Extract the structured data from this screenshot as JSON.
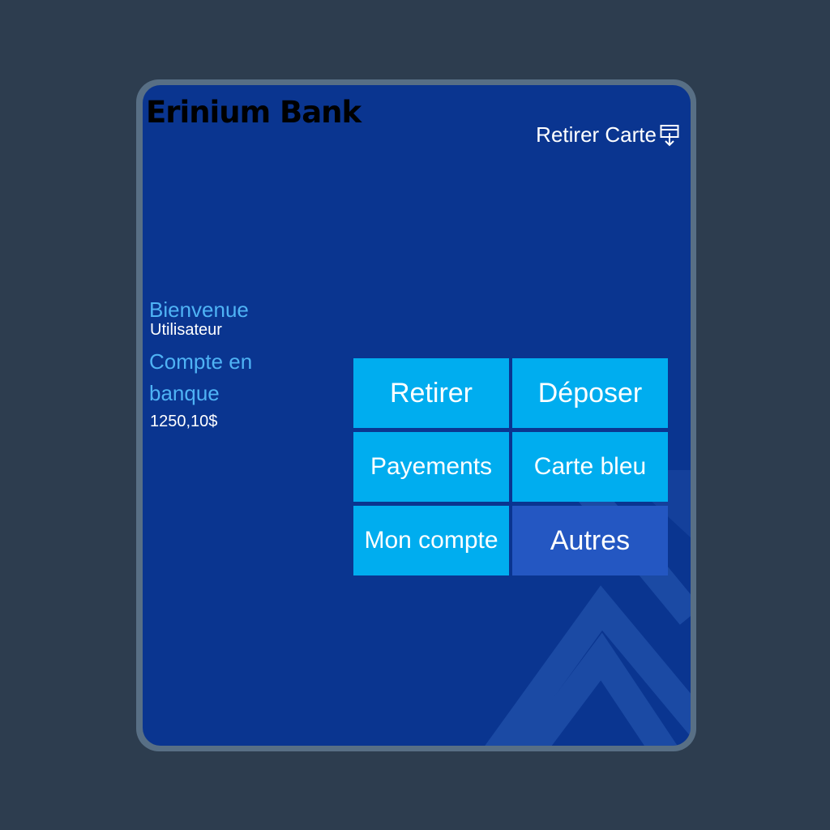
{
  "header": {
    "bank_name": "Erinium Bank",
    "eject_label": "Retirer Carte",
    "eject_icon": "card-eject-icon"
  },
  "account": {
    "welcome": "Bienvenue",
    "user": "Utilisateur",
    "account_label": "Compte en banque",
    "balance": "1250,10$"
  },
  "menu": {
    "withdraw": "Retirer",
    "deposit": "Déposer",
    "payments": "Payements",
    "blue_card": "Carte bleu",
    "my_account": "Mon compte",
    "others": "Autres"
  },
  "colors": {
    "background": "#2d3d4f",
    "frame": "#586f85",
    "screen": "#0a3590",
    "button": "#00adef",
    "button_alt": "#2457c2",
    "label_accent": "#4fb3f5"
  }
}
